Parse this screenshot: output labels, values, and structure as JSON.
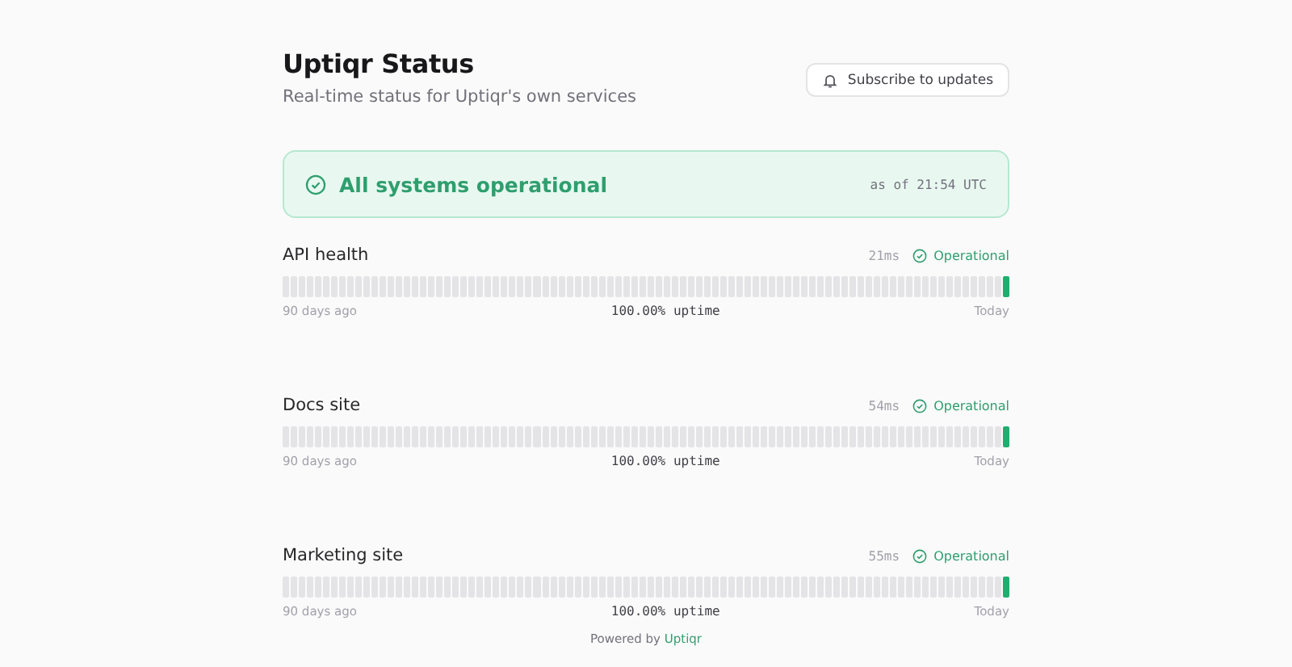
{
  "header": {
    "title": "Uptiqr Status",
    "subtitle": "Real-time status for Uptiqr's own services",
    "subscribe_button": "Subscribe to updates"
  },
  "banner": {
    "operational": true,
    "message": "All systems operational",
    "timestamp": "as of 21:54 UTC"
  },
  "services": [
    {
      "name": "API health",
      "latency": "21ms",
      "operational": true,
      "status_label": "Operational",
      "start_label": "90 days ago",
      "uptime": "100.00% uptime",
      "end_label": "Today",
      "days_up": [
        false,
        false,
        false,
        false,
        false,
        false,
        false,
        false,
        false,
        false,
        false,
        false,
        false,
        false,
        false,
        false,
        false,
        false,
        false,
        false,
        false,
        false,
        false,
        false,
        false,
        false,
        false,
        false,
        false,
        false,
        false,
        false,
        false,
        false,
        false,
        false,
        false,
        false,
        false,
        false,
        false,
        false,
        false,
        false,
        false,
        false,
        false,
        false,
        false,
        false,
        false,
        false,
        false,
        false,
        false,
        false,
        false,
        false,
        false,
        false,
        false,
        false,
        false,
        false,
        false,
        false,
        false,
        false,
        false,
        false,
        false,
        false,
        false,
        false,
        false,
        false,
        false,
        false,
        false,
        false,
        false,
        false,
        false,
        false,
        false,
        false,
        false,
        false,
        false,
        true
      ]
    },
    {
      "name": "Docs site",
      "latency": "54ms",
      "operational": true,
      "status_label": "Operational",
      "start_label": "90 days ago",
      "uptime": "100.00% uptime",
      "end_label": "Today",
      "days_up": [
        false,
        false,
        false,
        false,
        false,
        false,
        false,
        false,
        false,
        false,
        false,
        false,
        false,
        false,
        false,
        false,
        false,
        false,
        false,
        false,
        false,
        false,
        false,
        false,
        false,
        false,
        false,
        false,
        false,
        false,
        false,
        false,
        false,
        false,
        false,
        false,
        false,
        false,
        false,
        false,
        false,
        false,
        false,
        false,
        false,
        false,
        false,
        false,
        false,
        false,
        false,
        false,
        false,
        false,
        false,
        false,
        false,
        false,
        false,
        false,
        false,
        false,
        false,
        false,
        false,
        false,
        false,
        false,
        false,
        false,
        false,
        false,
        false,
        false,
        false,
        false,
        false,
        false,
        false,
        false,
        false,
        false,
        false,
        false,
        false,
        false,
        false,
        false,
        false,
        true
      ]
    },
    {
      "name": "Marketing site",
      "latency": "55ms",
      "operational": true,
      "status_label": "Operational",
      "start_label": "90 days ago",
      "uptime": "100.00% uptime",
      "end_label": "Today",
      "days_up": [
        false,
        false,
        false,
        false,
        false,
        false,
        false,
        false,
        false,
        false,
        false,
        false,
        false,
        false,
        false,
        false,
        false,
        false,
        false,
        false,
        false,
        false,
        false,
        false,
        false,
        false,
        false,
        false,
        false,
        false,
        false,
        false,
        false,
        false,
        false,
        false,
        false,
        false,
        false,
        false,
        false,
        false,
        false,
        false,
        false,
        false,
        false,
        false,
        false,
        false,
        false,
        false,
        false,
        false,
        false,
        false,
        false,
        false,
        false,
        false,
        false,
        false,
        false,
        false,
        false,
        false,
        false,
        false,
        false,
        false,
        false,
        false,
        false,
        false,
        false,
        false,
        false,
        false,
        false,
        false,
        false,
        false,
        false,
        false,
        false,
        false,
        false,
        false,
        false,
        true
      ]
    }
  ],
  "footer": {
    "prefix": "Powered by",
    "link": "Uptiqr"
  }
}
